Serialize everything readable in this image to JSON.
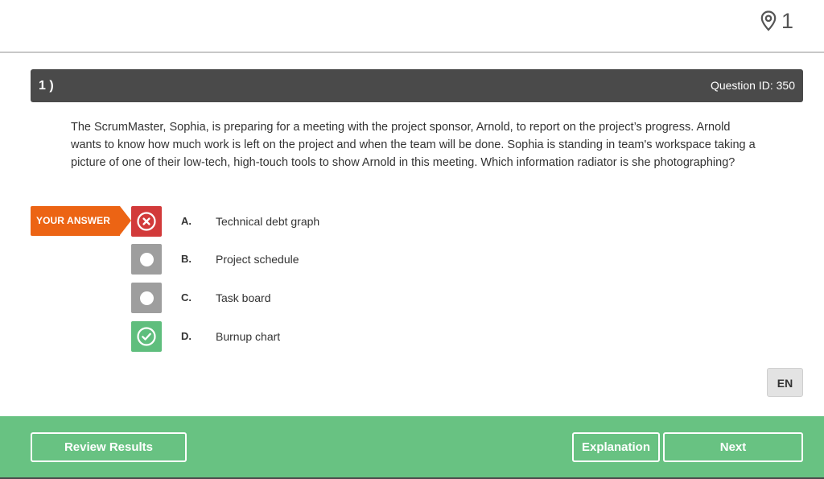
{
  "top": {
    "pin_count": "1",
    "pin_icon": "map-pin-icon"
  },
  "question": {
    "number": "1 )",
    "id_label": "Question ID: 350",
    "text": "The ScrumMaster, Sophia, is preparing for a meeting with the project sponsor, Arnold, to report on the project’s progress. Arnold wants to know how much work is left on the project and when the team will be done. Sophia is standing in team's workspace taking a picture of one of their low-tech, high-touch tools to show Arnold in this meeting. Which information radiator is she photographing?"
  },
  "your_answer_label": "YOUR ANSWER",
  "options": [
    {
      "letter": "A.",
      "text": "Technical debt graph",
      "state": "wrong",
      "icon": "x-circle-icon"
    },
    {
      "letter": "B.",
      "text": "Project schedule",
      "state": "neutral",
      "icon": "radio-dot-icon"
    },
    {
      "letter": "C.",
      "text": "Task board",
      "state": "neutral",
      "icon": "radio-dot-icon"
    },
    {
      "letter": "D.",
      "text": "Burnup chart",
      "state": "correct",
      "icon": "check-circle-icon"
    }
  ],
  "language": "EN",
  "footer": {
    "review_label": "Review Results",
    "explanation_label": "Explanation",
    "next_label": "Next"
  },
  "colors": {
    "header_bg": "#4a4a4a",
    "your_answer": "#ec6414",
    "wrong": "#d23a3a",
    "neutral": "#9e9e9e",
    "correct": "#5fbe7d",
    "footer_bg": "#68c282"
  }
}
